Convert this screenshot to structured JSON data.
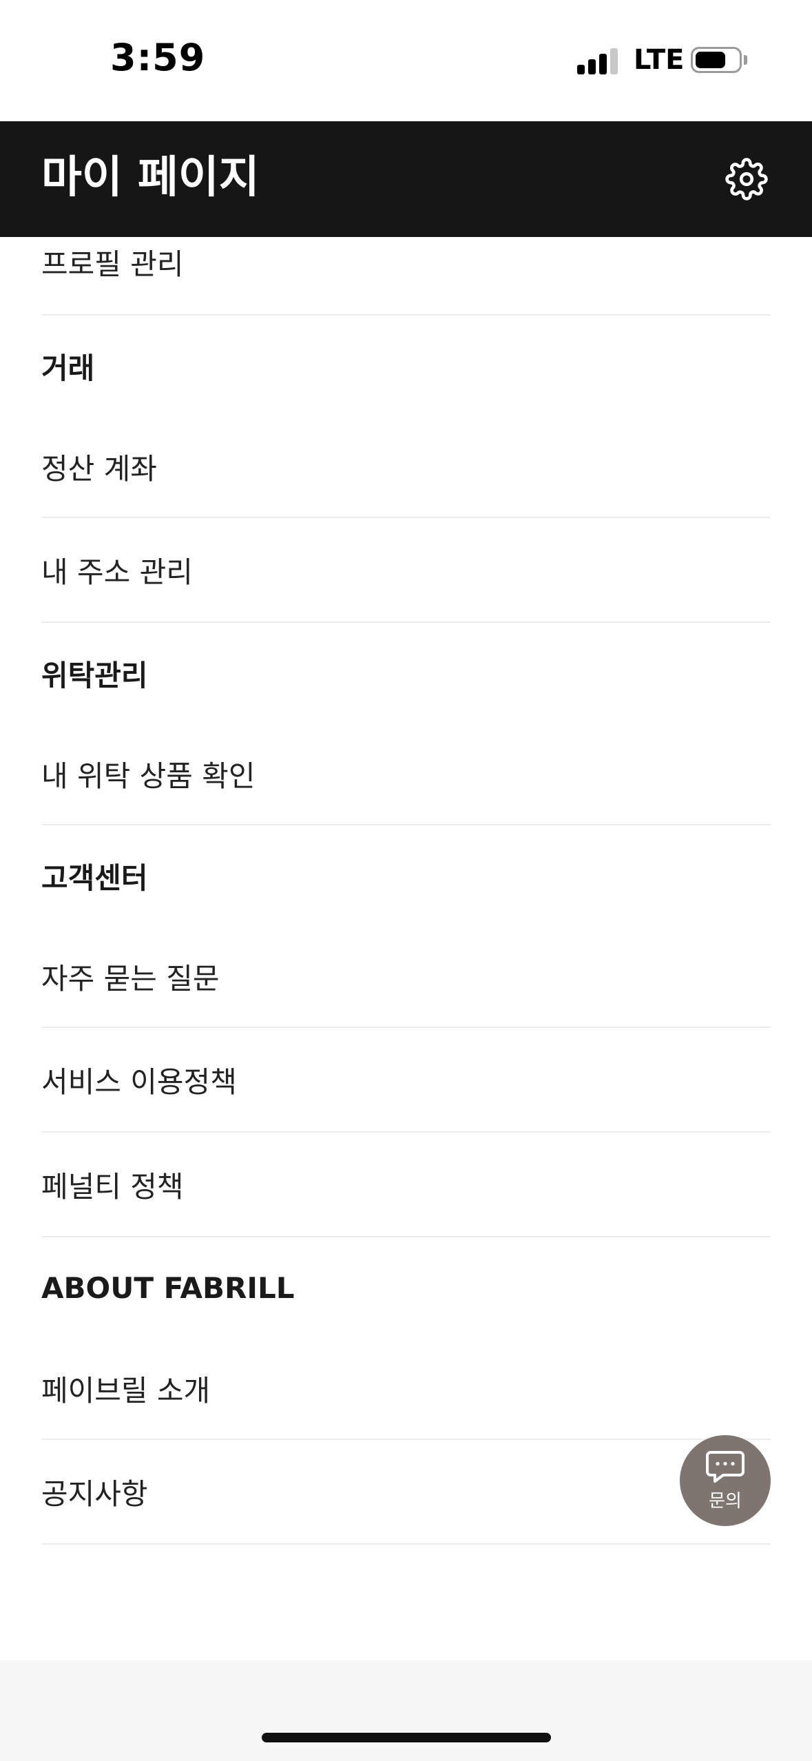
{
  "status_bar": {
    "time": "3:59",
    "network": "LTE",
    "battery_level": 0.72
  },
  "header": {
    "title": "마이 페이지",
    "settings_icon": "gear-icon"
  },
  "menu": {
    "profile_item": "프로필 관리",
    "sections": [
      {
        "title": "거래",
        "items": [
          "정산 계좌",
          "내 주소 관리"
        ]
      },
      {
        "title": "위탁관리",
        "items": [
          "내 위탁 상품 확인"
        ]
      },
      {
        "title": "고객센터",
        "items": [
          "자주 묻는 질문",
          "서비스 이용정책",
          "페널티 정책"
        ]
      },
      {
        "title": "ABOUT FABRILL",
        "items": [
          "페이브릴 소개",
          "공지사항"
        ]
      }
    ]
  },
  "fab": {
    "label": "문의",
    "icon": "chat-bubble-icon",
    "color": "#7e7571"
  },
  "colors": {
    "header_bg": "#161616",
    "divider": "#ececec"
  }
}
